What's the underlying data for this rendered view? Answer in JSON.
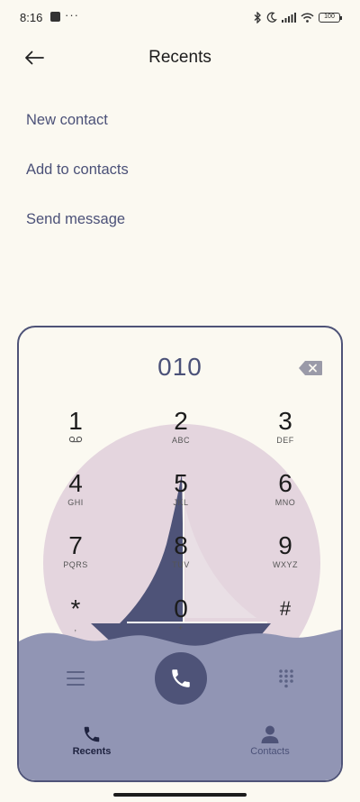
{
  "status": {
    "time": "8:16",
    "dots": "···",
    "battery": "100"
  },
  "header": {
    "title": "Recents"
  },
  "actions": [
    {
      "label": "New contact"
    },
    {
      "label": "Add to contacts"
    },
    {
      "label": "Send message"
    }
  ],
  "dialer": {
    "number": "010",
    "keys": [
      {
        "digit": "1",
        "letters": ""
      },
      {
        "digit": "2",
        "letters": "ABC"
      },
      {
        "digit": "3",
        "letters": "DEF"
      },
      {
        "digit": "4",
        "letters": "GHI"
      },
      {
        "digit": "5",
        "letters": "JKL"
      },
      {
        "digit": "6",
        "letters": "MNO"
      },
      {
        "digit": "7",
        "letters": "PQRS"
      },
      {
        "digit": "8",
        "letters": "TUV"
      },
      {
        "digit": "9",
        "letters": "WXYZ"
      },
      {
        "digit": "*",
        "letters": ","
      },
      {
        "digit": "0",
        "letters": "+"
      },
      {
        "digit": "#",
        "letters": ""
      }
    ]
  },
  "tabs": [
    {
      "label": "Recents",
      "icon": "phone-icon",
      "active": true
    },
    {
      "label": "Contacts",
      "icon": "person-icon",
      "active": false
    }
  ],
  "colors": {
    "background": "#fbf9f1",
    "accent": "#4e5378",
    "sun": "#e4d5de",
    "sea": "#9195b4",
    "action_text": "#4b5178"
  }
}
